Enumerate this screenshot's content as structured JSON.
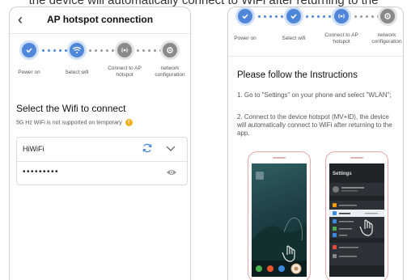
{
  "caption": "the device will automatically connect to WiFi after returning to the",
  "left": {
    "back_symbol": "‹",
    "title": "AP hotspot connection",
    "steps": [
      {
        "label": "Power on",
        "icon": "check-icon",
        "state": "active"
      },
      {
        "label": "Select wifi",
        "icon": "wifi-icon",
        "state": "active"
      },
      {
        "label": "Connect to AP hotspot",
        "icon": "hotspot-icon",
        "state": "inactive"
      },
      {
        "label": "network configuration",
        "icon": "gear-icon",
        "state": "inactive"
      }
    ],
    "section_title": "Select the Wifi to connect",
    "note": "5G Hz WiFi is not supported on temporary",
    "wifi_name": "HiWiFi",
    "password_mask": "•••••••••"
  },
  "right": {
    "steps": [
      {
        "label": "Power on",
        "icon": "check-icon",
        "state": "active"
      },
      {
        "label": "Select wifi",
        "icon": "check-icon",
        "state": "active"
      },
      {
        "label": "Connect to AP hotspot",
        "icon": "hotspot-icon",
        "state": "active"
      },
      {
        "label": "network configuration",
        "icon": "gear-icon",
        "state": "inactive"
      }
    ],
    "instructions_title": "Please follow the Instructions",
    "instruction_1": "1. Go to \"Settings\" on your phone and select \"WLAN\";",
    "instruction_2": "2. Connect to the device hotspot (MV+ID), the device will automatically connect to WiFi after returning to the app.",
    "settings_title": "Settings",
    "settings_items": [
      "Airplane Mode",
      "WLAN",
      "Bluetooth",
      "Cellular",
      "VPN",
      "Notifications",
      "Control Center"
    ]
  },
  "colors": {
    "accent": "#4f86d9",
    "inactive": "#8a8a8a",
    "warning": "#f2b01e"
  }
}
